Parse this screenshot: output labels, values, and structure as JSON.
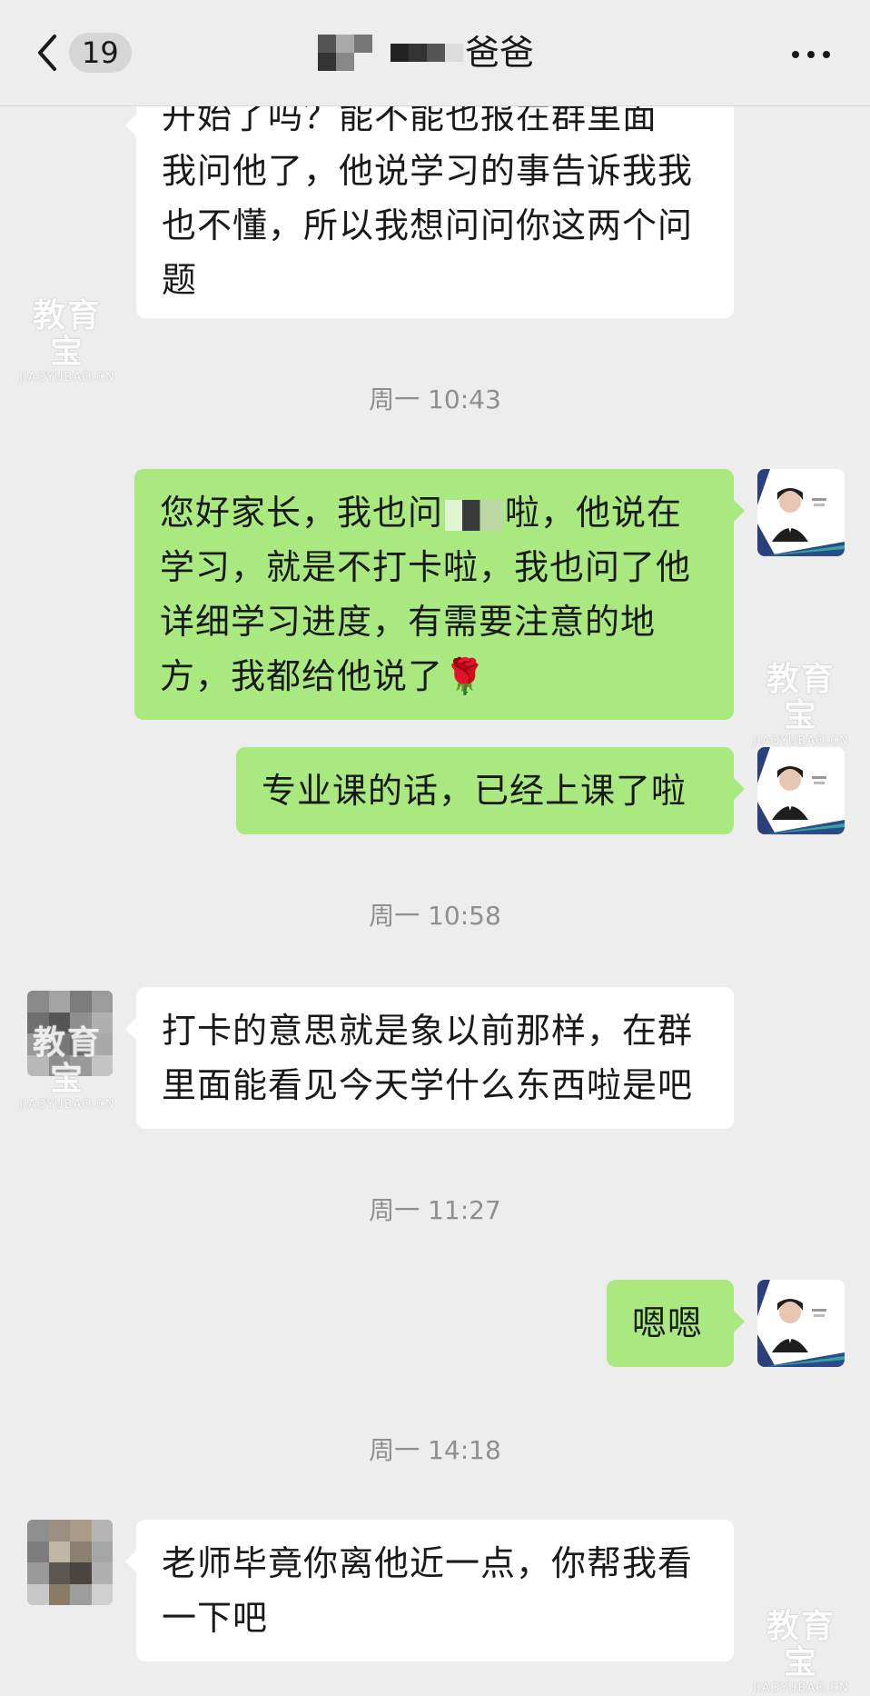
{
  "header": {
    "unread_count": "19",
    "title_suffix": "爸爸",
    "back_icon": "chevron-left-icon",
    "more_icon": "more-dots-icon"
  },
  "messages": [
    {
      "side": "left",
      "text_lines": [
        "开始了吗？能不能也报在群里面",
        "我问他了，他说学习的事告诉我我",
        "也不懂，所以我想问问你这两个问",
        "题"
      ]
    },
    {
      "timestamp": "周一 10:43"
    },
    {
      "side": "right",
      "text_before_redact": "您好家长，我也问",
      "text_after_redact": "啦，他说在",
      "text_lines": [
        "学习，就是不打卡啦，我也问了他",
        "详细学习进度，有需要注意的地",
        "方，我都给他说了"
      ],
      "emoji": "🌹"
    },
    {
      "side": "right",
      "text": "专业课的话，已经上课了啦"
    },
    {
      "timestamp": "周一 10:58"
    },
    {
      "side": "left",
      "text_lines": [
        "打卡的意思就是象以前那样，在群",
        "里面能看见今天学什么东西啦是吧"
      ]
    },
    {
      "timestamp": "周一 11:27"
    },
    {
      "side": "right",
      "text": "嗯嗯"
    },
    {
      "timestamp": "周一 14:18"
    },
    {
      "side": "left",
      "text_lines": [
        "老师毕竟你离他近一点，你帮我看",
        "一下吧"
      ]
    }
  ],
  "watermark": {
    "brand": "教育宝",
    "url": "JIAOYUBAO.CN"
  },
  "colors": {
    "background": "#ededed",
    "left_bubble": "#ffffff",
    "right_bubble": "#a9e97f",
    "timestamp": "#8f8f8f"
  }
}
